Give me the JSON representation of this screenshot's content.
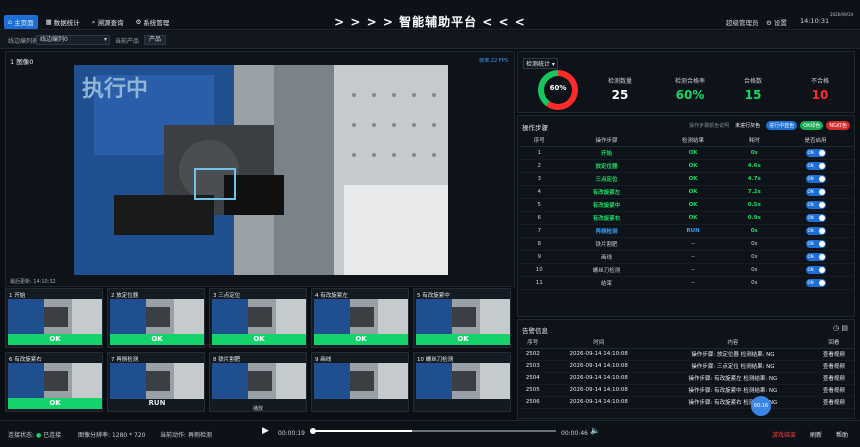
{
  "nav": [
    {
      "label": "主页面",
      "icon": "home-icon",
      "active": true
    },
    {
      "label": "数据统计",
      "icon": "chart-icon",
      "active": false
    },
    {
      "label": "溯源查询",
      "icon": "search-icon",
      "active": false
    },
    {
      "label": "系统管理",
      "icon": "gear-icon",
      "active": false
    }
  ],
  "title": "> > > > 智能辅助平台 < < < <",
  "header": {
    "user": "超级管理员",
    "settings": "设置",
    "time": "14:10:31",
    "date": "2026/09/14"
  },
  "filters": {
    "line_label": "线边编列表",
    "line_value": "线边编列0",
    "product_label": "当前产品",
    "product_value": "产品"
  },
  "camera": {
    "title": "1 图像0",
    "fps": "帧率:22 FPS",
    "running_text": "执行中",
    "updated": "最后更新: 14:10:32"
  },
  "thumbs": [
    {
      "label": "1 开始",
      "status": "OK"
    },
    {
      "label": "2 放定位器",
      "status": "OK"
    },
    {
      "label": "3 三点定位",
      "status": "OK"
    },
    {
      "label": "4 有改旋紧左",
      "status": "OK"
    },
    {
      "label": "5 有改旋紧中",
      "status": "OK"
    },
    {
      "label": "6 有改旋紧右",
      "status": "OK"
    },
    {
      "label": "7 再侧检测",
      "status": "RUN"
    },
    {
      "label": "8 铁片割肥",
      "status": ""
    },
    {
      "label": "9 画线",
      "status": ""
    },
    {
      "label": "10 螺丝刀检测",
      "status": ""
    }
  ],
  "stats": {
    "title": "检测统计",
    "donut_pct": 60,
    "donut_text": "60%",
    "items": [
      {
        "label": "检测数量",
        "value": "25",
        "color": "#ffffff"
      },
      {
        "label": "检测合格率",
        "value": "60%",
        "color": "#16d868"
      },
      {
        "label": "合格数",
        "value": "15",
        "color": "#16d868"
      },
      {
        "label": "不合格",
        "value": "10",
        "color": "#ff2a2a"
      }
    ]
  },
  "steps": {
    "title": "操作步骤",
    "hint": "操作步骤颜色说明",
    "legend": [
      {
        "label": "未进行灰色",
        "color": "transparent"
      },
      {
        "label": "进行中蓝色",
        "color": "#1d6fd6"
      },
      {
        "label": "OK绿色",
        "color": "#16a852"
      },
      {
        "label": "NG红色",
        "color": "#d42a2a"
      }
    ],
    "headers": [
      "序号",
      "操作步骤",
      "检测结果",
      "耗时",
      "是否启用"
    ],
    "rows": [
      {
        "no": "1",
        "name": "开始",
        "result": "OK",
        "time": "0s",
        "state": "ok"
      },
      {
        "no": "2",
        "name": "放定位器",
        "result": "OK",
        "time": "4.6s",
        "state": "ok"
      },
      {
        "no": "3",
        "name": "三点定位",
        "result": "OK",
        "time": "4.7s",
        "state": "ok"
      },
      {
        "no": "4",
        "name": "有改旋紧左",
        "result": "OK",
        "time": "7.2s",
        "state": "ok"
      },
      {
        "no": "5",
        "name": "有改旋紧中",
        "result": "OK",
        "time": "0.5s",
        "state": "ok"
      },
      {
        "no": "6",
        "name": "有改旋紧右",
        "result": "OK",
        "time": "0.9s",
        "state": "ok"
      },
      {
        "no": "7",
        "name": "再侧检测",
        "result": "RUN",
        "time": "0s",
        "state": "run"
      },
      {
        "no": "8",
        "name": "铁片割肥",
        "result": "--",
        "time": "0s",
        "state": "idle"
      },
      {
        "no": "9",
        "name": "画线",
        "result": "--",
        "time": "0s",
        "state": "idle"
      },
      {
        "no": "10",
        "name": "螺丝刀检测",
        "result": "--",
        "time": "0s",
        "state": "idle"
      },
      {
        "no": "11",
        "name": "结束",
        "result": "--",
        "time": "0s",
        "state": "idle"
      }
    ],
    "toggle_label": "ON"
  },
  "alarms": {
    "title": "告警信息",
    "headers": [
      "序号",
      "时间",
      "内容",
      "回看"
    ],
    "rows": [
      {
        "no": "2502",
        "time": "2026-09-14 14:10:08",
        "content": "操作步骤: 放定位器 检测结果: NG",
        "action": "查看视频"
      },
      {
        "no": "2503",
        "time": "2026-09-14 14:10:08",
        "content": "操作步骤: 三点定位 检测结果: NG",
        "action": "查看视频"
      },
      {
        "no": "2504",
        "time": "2026-09-14 14:10:08",
        "content": "操作步骤: 有改旋紧左 检测结果: NG",
        "action": "查看视频"
      },
      {
        "no": "2505",
        "time": "2026-09-14 14:10:08",
        "content": "操作步骤: 有改旋紧中 检测结果: NG",
        "action": "查看视频"
      },
      {
        "no": "2506",
        "time": "2026-09-14 14:10:08",
        "content": "操作步骤: 有改旋紧右 检测结果: NG",
        "action": "查看视频"
      }
    ]
  },
  "bottom": {
    "conn_label": "连接状态:",
    "conn_value": "已连接",
    "res_label": "图像分辨率:",
    "res_value": "1280 * 720",
    "action_label": "当前动作:",
    "action_value": "再侧检测",
    "tooltip": "播放",
    "time_cur": "00:00:19",
    "time_total": "00:00:46",
    "progress": 0.41,
    "dot_text": "00:16",
    "stop": "游戏结束",
    "refresh": "刷新",
    "help": "帮助"
  }
}
